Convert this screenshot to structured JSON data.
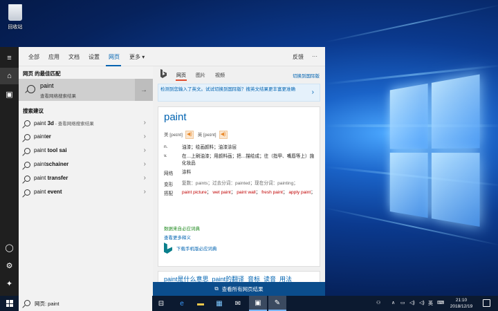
{
  "desktop": {
    "recycle_bin_label": "回收站"
  },
  "tabs": [
    "全部",
    "应用",
    "文档",
    "设置",
    "网页",
    "更多"
  ],
  "tabs_more_arrow": "▾",
  "feedback_label": "反馈",
  "ellipsis": "···",
  "left": {
    "best_match_header": "网页 的最佳匹配",
    "best_match": {
      "query": "paint",
      "subtitle": "查看网络搜索结果"
    },
    "suggestions_header": "搜索建议",
    "suggestions": [
      {
        "prefix": "paint",
        "bold": " 3d",
        "sub": " - 查看网络搜索结果"
      },
      {
        "prefix": "paint",
        "bold": "er",
        "sub": ""
      },
      {
        "prefix": "paint",
        "bold": " tool sai",
        "sub": ""
      },
      {
        "prefix": "paint",
        "bold": "schainer",
        "sub": ""
      },
      {
        "prefix": "paint",
        "bold": " transfer",
        "sub": ""
      },
      {
        "prefix": "paint",
        "bold": " event",
        "sub": ""
      }
    ]
  },
  "right": {
    "tabs": [
      "网页",
      "图片",
      "视频"
    ],
    "intl_link": "切换到国际版",
    "banner": "检测到您输入了英文。试试切换到国际版？搜英文结果更丰富更准确",
    "word": "paint",
    "pron_us": "美 [peɪnt]",
    "pron_uk": "英 [peɪnt]",
    "definitions": [
      {
        "pos": "n.",
        "text": "油漆；绘画颜料；油漆涂层"
      },
      {
        "pos": "v.",
        "text": "在…上刷油漆；用颜料画；把…描绘成；往（指甲、嘴唇等上）施化妆品"
      },
      {
        "pos": "网络",
        "text": "涂料"
      }
    ],
    "forms_label": "变形",
    "forms_text": "复数：paints；过去分词：painted；现在分词：painting；",
    "collocation_label": "搭配",
    "collocations": [
      "paint picture",
      "wet paint",
      "paint wall",
      "fresh paint",
      "apply paint"
    ],
    "source": "数据来自必应词典",
    "more_link": "查看更多释义",
    "download": "下载手机版必应词典",
    "second_result": "paint是什么意思_paint的翻译_音标_读音_用法",
    "see_all": "查看所有网页结果"
  },
  "taskbar": {
    "search_text": "网页: paint",
    "ime": "英",
    "time": "21:10",
    "date": "2018/12/19"
  }
}
